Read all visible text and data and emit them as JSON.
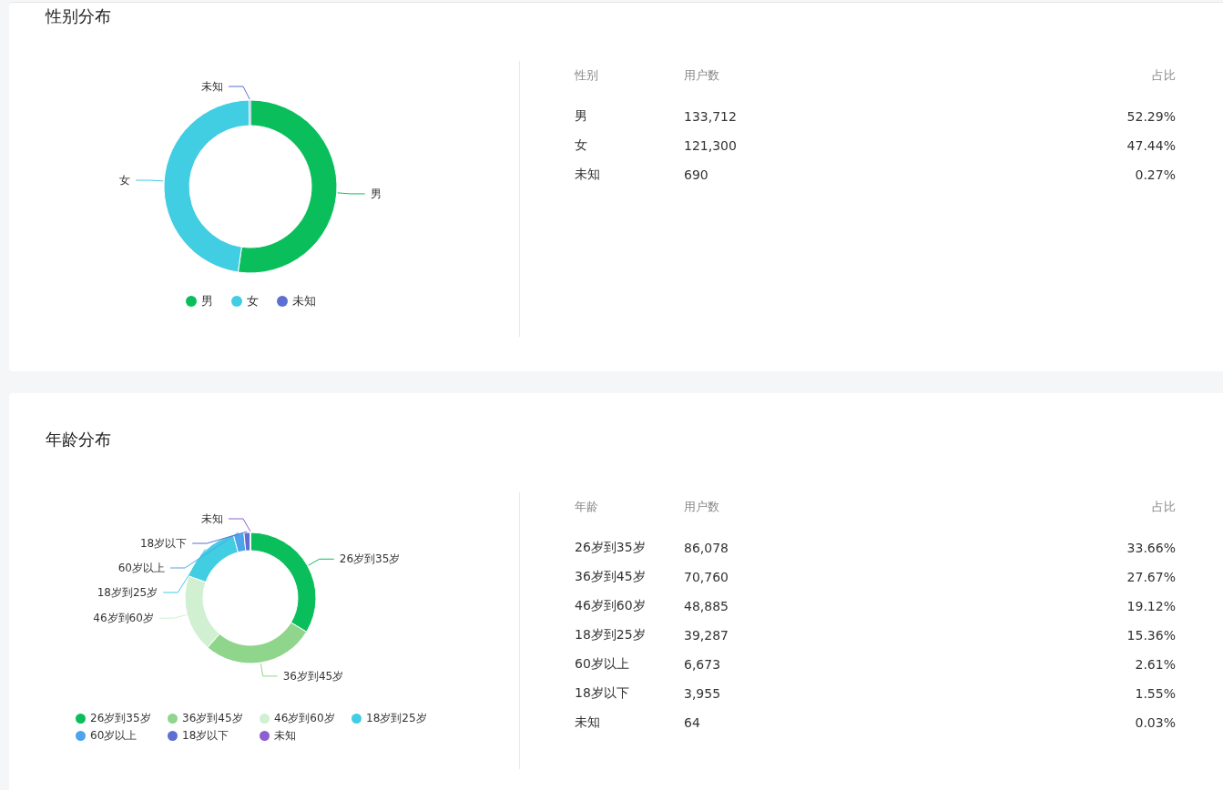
{
  "sections": [
    {
      "title": "性别分布",
      "chart_data": {
        "type": "donut",
        "categories": [
          "男",
          "女",
          "未知"
        ],
        "values": [
          52.29,
          47.44,
          0.27
        ]
      },
      "legend": [
        {
          "label": "男",
          "color": "#0abf5b"
        },
        {
          "label": "女",
          "color": "#41cde2"
        },
        {
          "label": "未知",
          "color": "#5d6fd3"
        }
      ],
      "table": {
        "columns": [
          "性别",
          "用户数",
          "占比"
        ],
        "rows": [
          [
            "男",
            "133,712",
            "52.29%"
          ],
          [
            "女",
            "121,300",
            "47.44%"
          ],
          [
            "未知",
            "690",
            "0.27%"
          ]
        ]
      }
    },
    {
      "title": "年龄分布",
      "chart_data": {
        "type": "donut",
        "categories": [
          "26岁到35岁",
          "36岁到45岁",
          "46岁到60岁",
          "18岁到25岁",
          "60岁以上",
          "18岁以下",
          "未知"
        ],
        "values": [
          33.66,
          27.67,
          19.12,
          15.36,
          2.61,
          1.55,
          0.03
        ]
      },
      "legend": [
        {
          "label": "26岁到35岁",
          "color": "#0abf5b"
        },
        {
          "label": "36岁到45岁",
          "color": "#8fd68c"
        },
        {
          "label": "46岁到60岁",
          "color": "#d1f0d2"
        },
        {
          "label": "18岁到25岁",
          "color": "#41cde2"
        },
        {
          "label": "60岁以上",
          "color": "#4ea4ec"
        },
        {
          "label": "18岁以下",
          "color": "#5d6fd3"
        },
        {
          "label": "未知",
          "color": "#8e5fd1"
        }
      ],
      "table": {
        "columns": [
          "年龄",
          "用户数",
          "占比"
        ],
        "rows": [
          [
            "26岁到35岁",
            "86,078",
            "33.66%"
          ],
          [
            "36岁到45岁",
            "70,760",
            "27.67%"
          ],
          [
            "46岁到60岁",
            "48,885",
            "19.12%"
          ],
          [
            "18岁到25岁",
            "39,287",
            "15.36%"
          ],
          [
            "60岁以上",
            "6,673",
            "2.61%"
          ],
          [
            "18岁以下",
            "3,955",
            "1.55%"
          ],
          [
            "未知",
            "64",
            "0.03%"
          ]
        ]
      }
    }
  ]
}
